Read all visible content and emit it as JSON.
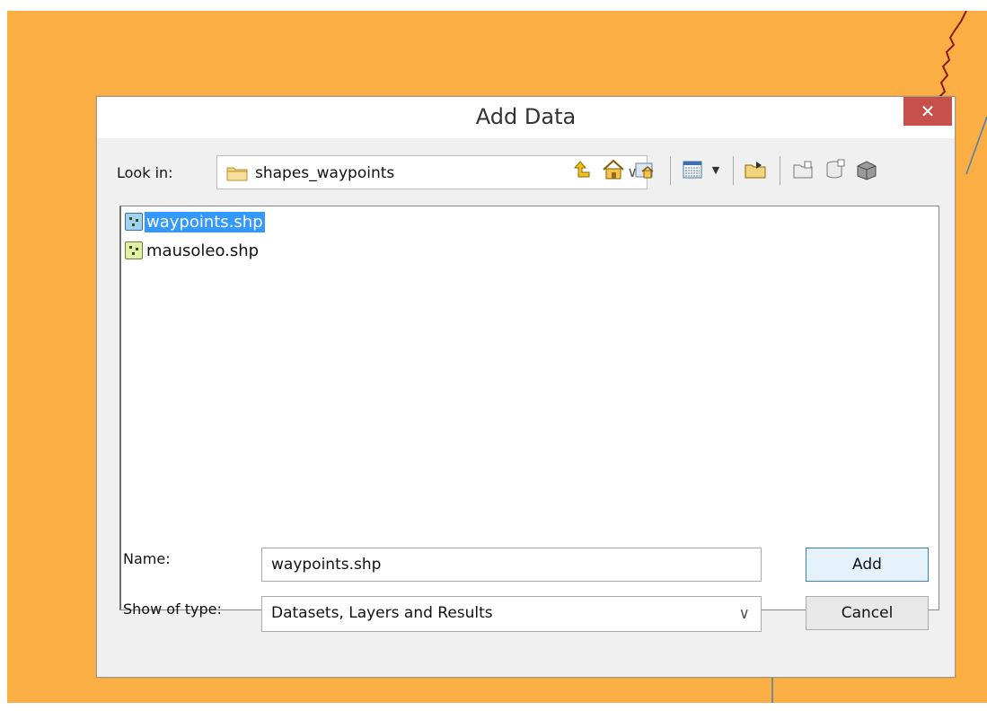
{
  "dialog": {
    "title": "Add Data",
    "close_glyph": "✕"
  },
  "look_in": {
    "label": "Look in:",
    "value": "shapes_waypoints"
  },
  "toolbar": {
    "icons": [
      "up-one-level-icon",
      "home-icon",
      "catalog-home-icon",
      "view-list-icon",
      "view-dropdown-icon",
      "connect-folder-icon",
      "new-folder-icon",
      "new-geodatabase-icon",
      "toolbox-icon"
    ]
  },
  "files": [
    {
      "name": "waypoints.shp",
      "selected": true
    },
    {
      "name": "mausoleo.shp",
      "selected": false
    }
  ],
  "name_field": {
    "label": "Name:",
    "value": "waypoints.shp"
  },
  "type_field": {
    "label": "Show of type:",
    "value": "Datasets, Layers and Results"
  },
  "buttons": {
    "add": "Add",
    "cancel": "Cancel"
  },
  "colors": {
    "background": "#FBAE43",
    "close_button": "#C7504B",
    "selection": "#3399FF"
  }
}
